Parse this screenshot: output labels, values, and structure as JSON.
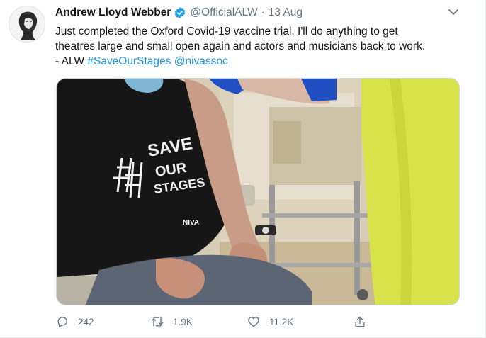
{
  "tweet": {
    "author_name": "Andrew Lloyd Webber",
    "handle": "@OfficialALW",
    "separator": "·",
    "date": "13 Aug",
    "text_line1": "Just completed the Oxford Covid-19 vaccine trial. I'll do anything to get",
    "text_line2": "theatres large and small open again and actors and musicians back to work.",
    "text_line3_prefix": "- ALW ",
    "hashtag": "#SaveOurStages",
    "mention": "@nivassoc",
    "shirt_text": {
      "word1": "SAVE",
      "word2": "OUR",
      "word3": "STAGES",
      "brand": "NIVA"
    }
  },
  "actions": {
    "replies": "242",
    "retweets": "1.9K",
    "likes": "11.2K"
  },
  "colors": {
    "link": "#1b95e0",
    "muted": "#657786",
    "verified": "#1da1f2",
    "text": "#14171a"
  },
  "icons": {
    "verified": "verified-badge-icon",
    "caret": "chevron-down-icon",
    "reply": "reply-icon",
    "retweet": "retweet-icon",
    "like": "heart-icon",
    "share": "share-icon"
  }
}
